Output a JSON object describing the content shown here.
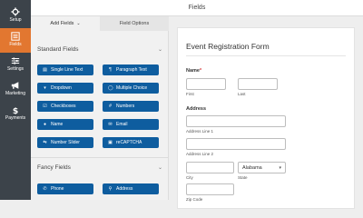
{
  "nav": {
    "items": [
      {
        "label": "Setup",
        "icon": "gear-icon",
        "active": false
      },
      {
        "label": "Fields",
        "icon": "list-icon",
        "active": true
      },
      {
        "label": "Settings",
        "icon": "sliders-icon",
        "active": false
      },
      {
        "label": "Marketing",
        "icon": "megaphone-icon",
        "active": false
      },
      {
        "label": "Payments",
        "icon": "dollar-icon",
        "active": false
      }
    ],
    "active_color": "#e27730",
    "background": "#3c434a"
  },
  "header": {
    "title": "Fields"
  },
  "panel": {
    "tabs": [
      {
        "label": "Add Fields",
        "active": true
      },
      {
        "label": "Field Options",
        "active": false
      }
    ],
    "standard_title": "Standard Fields",
    "standard_fields": [
      {
        "label": "Single Line Text",
        "icon": "text-line-icon"
      },
      {
        "label": "Paragraph Text",
        "icon": "paragraph-icon"
      },
      {
        "label": "Dropdown",
        "icon": "dropdown-icon"
      },
      {
        "label": "Multiple Choice",
        "icon": "radio-list-icon"
      },
      {
        "label": "Checkboxes",
        "icon": "checkbox-icon"
      },
      {
        "label": "Numbers",
        "icon": "hash-icon"
      },
      {
        "label": "Name",
        "icon": "user-icon"
      },
      {
        "label": "Email",
        "icon": "envelope-icon"
      },
      {
        "label": "Number Slider",
        "icon": "slider-icon"
      },
      {
        "label": "reCAPTCHA",
        "icon": "robot-icon"
      }
    ],
    "fancy_title": "Fancy Fields",
    "fancy_fields": [
      {
        "label": "Phone",
        "icon": "phone-icon"
      },
      {
        "label": "Address",
        "icon": "map-pin-icon"
      }
    ],
    "button_color": "#0e5d9f"
  },
  "form": {
    "title": "Event Registration Form",
    "name_label": "Name",
    "required_mark": "*",
    "first_label": "First",
    "last_label": "Last",
    "address_label": "Address",
    "address1_label": "Address Line 1",
    "address2_label": "Address Line 2",
    "city_label": "City",
    "state_label": "State",
    "state_value": "Alabama",
    "zip_label": "Zip Code"
  }
}
